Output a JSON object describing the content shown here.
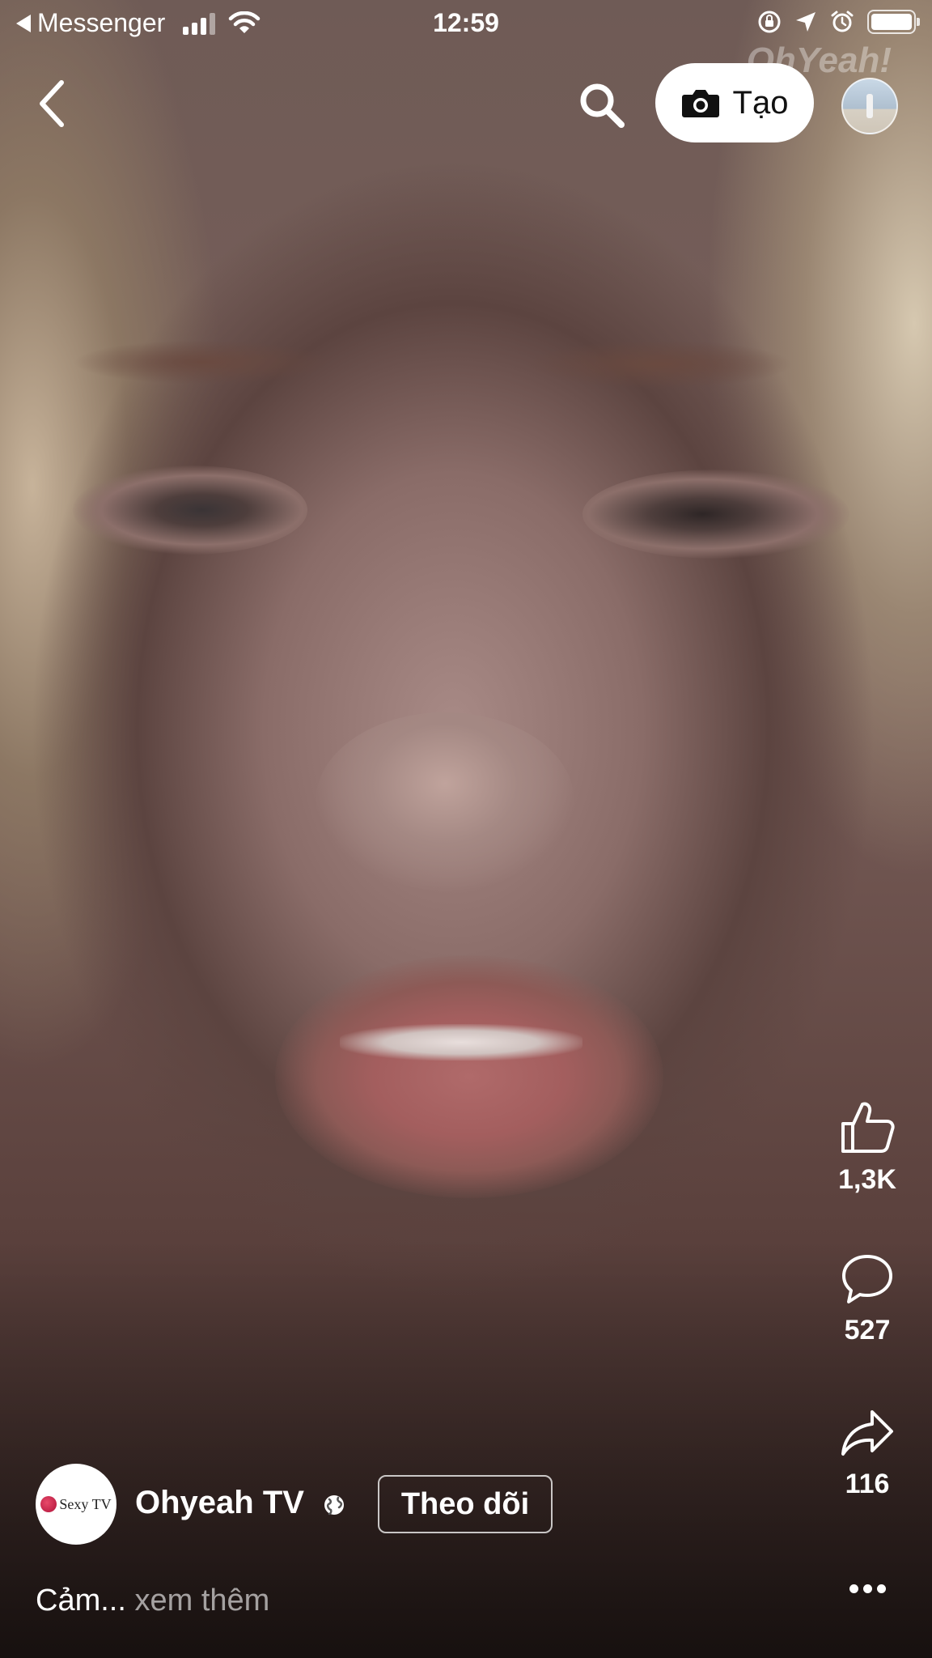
{
  "status_bar": {
    "back_app": "Messenger",
    "time": "12:59"
  },
  "video": {
    "watermark": "OhYeah!"
  },
  "top_nav": {
    "create_label": "Tạo"
  },
  "actions": {
    "likes": "1,3K",
    "comments": "527",
    "shares": "116"
  },
  "author": {
    "name": "Ohyeah TV",
    "logo_text": "Sexy TV",
    "follow_label": "Theo dõi"
  },
  "caption": {
    "text": "Cảm...",
    "see_more": "xem thêm"
  },
  "colors": {
    "button_bg": "#ffffff",
    "text_primary": "#ffffff",
    "text_muted": "rgba(255,255,255,0.6)"
  }
}
